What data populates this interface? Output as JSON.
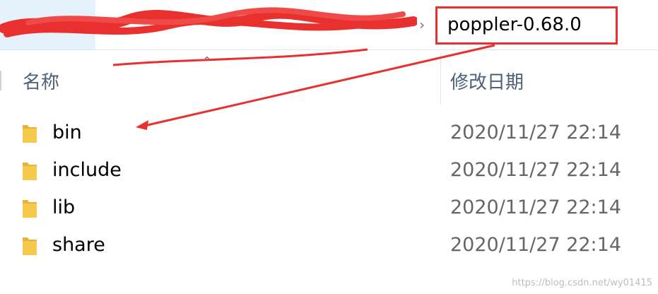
{
  "address_bar": {
    "current_folder": "poppler-0.68.0",
    "chevron": "›"
  },
  "columns": {
    "name": "名称",
    "modified": "修改日期"
  },
  "files": [
    {
      "name": "bin",
      "modified": "2020/11/27 22:14",
      "icon": "folder-icon"
    },
    {
      "name": "include",
      "modified": "2020/11/27 22:14",
      "icon": "folder-icon"
    },
    {
      "name": "lib",
      "modified": "2020/11/27 22:14",
      "icon": "folder-icon"
    },
    {
      "name": "share",
      "modified": "2020/11/27 22:14",
      "icon": "folder-icon"
    }
  ],
  "watermark": "https://blog.csdn.net/wy01415",
  "colors": {
    "annotation": "#e8302f",
    "folder": "#f5c94c",
    "header_text": "#4c607a",
    "date_text": "#666666"
  }
}
